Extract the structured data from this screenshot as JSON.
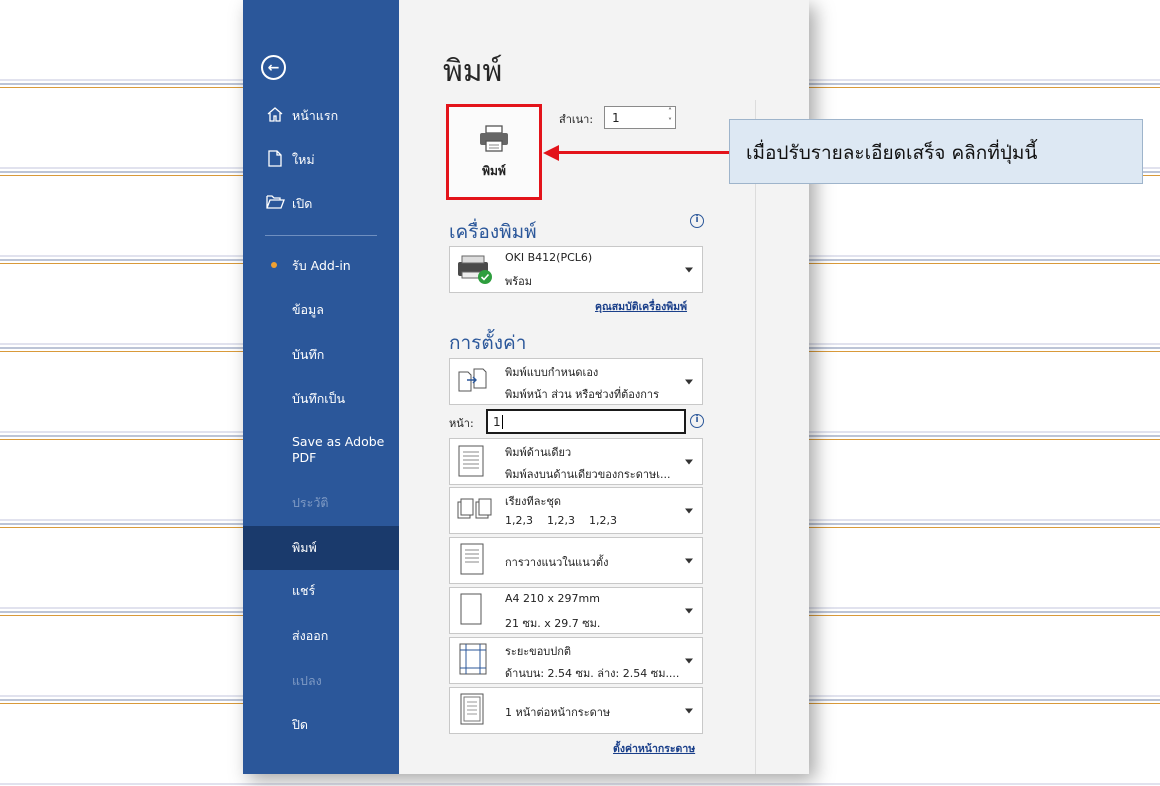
{
  "sidebar": {
    "back": "←",
    "items": [
      {
        "label": "หน้าแรก",
        "icon": "home-icon"
      },
      {
        "label": "ใหม่",
        "icon": "new-file-icon"
      },
      {
        "label": "เปิด",
        "icon": "folder-open-icon"
      },
      {
        "label": "รับ Add-in"
      },
      {
        "label": "ข้อมูล"
      },
      {
        "label": "บันทึก"
      },
      {
        "label": "บันทึกเป็น"
      },
      {
        "label": "Save as Adobe PDF"
      },
      {
        "label": "ประวัติ",
        "disabled": true
      },
      {
        "label": "พิมพ์",
        "active": true
      },
      {
        "label": "แชร์"
      },
      {
        "label": "ส่งออก"
      },
      {
        "label": "แปลง",
        "disabled": true
      },
      {
        "label": "ปิด"
      }
    ]
  },
  "main": {
    "title": "พิมพ์",
    "print_button": "พิมพ์",
    "copies_label": "สำเนา:",
    "copies_value": "1",
    "printer_heading": "เครื่องพิมพ์",
    "printer": {
      "name": "OKI B412(PCL6)",
      "status": "พร้อม"
    },
    "printer_properties_link": "คุณสมบัติเครื่องพิมพ์",
    "settings_heading": "การตั้งค่า",
    "settings": [
      {
        "line1": "พิมพ์แบบกำหนดเอง",
        "line2": "พิมพ์หน้า ส่วน หรือช่วงที่ต้องการ",
        "icon": "custom-print-icon"
      },
      {
        "line1": "พิมพ์ด้านเดียว",
        "line2": "พิมพ์ลงบนด้านเดียวของกระดาษเ...",
        "icon": "one-sided-icon"
      },
      {
        "line1": "เรียงทีละชุด",
        "line2": "1,2,3    1,2,3    1,2,3",
        "icon": "collated-icon"
      },
      {
        "line1": "การวางแนวในแนวตั้ง",
        "line2": "",
        "icon": "portrait-icon"
      },
      {
        "line1": "A4 210 x 297mm",
        "line2": "21 ซม. x 29.7 ซม.",
        "icon": "paper-size-icon"
      },
      {
        "line1": "ระยะขอบปกติ",
        "line2": "ด้านบน: 2.54 ซม. ล่าง: 2.54 ซม....",
        "icon": "margins-icon"
      },
      {
        "line1": "1 หน้าต่อหน้ากระดาษ",
        "line2": "",
        "icon": "pages-per-sheet-icon"
      }
    ],
    "pages_label": "หน้า:",
    "pages_value": "1",
    "page_setup_link": "ตั้งค่าหน้ากระดาษ"
  },
  "callout": {
    "text": "เมื่อปรับรายละเอียดเสร็จ คลิกที่ปุ่มนี้"
  },
  "colors": {
    "sidebar": "#2b579a",
    "sidebar_active": "#1a3a6c",
    "highlight": "#e3131a",
    "callout_bg": "#dde8f3"
  }
}
